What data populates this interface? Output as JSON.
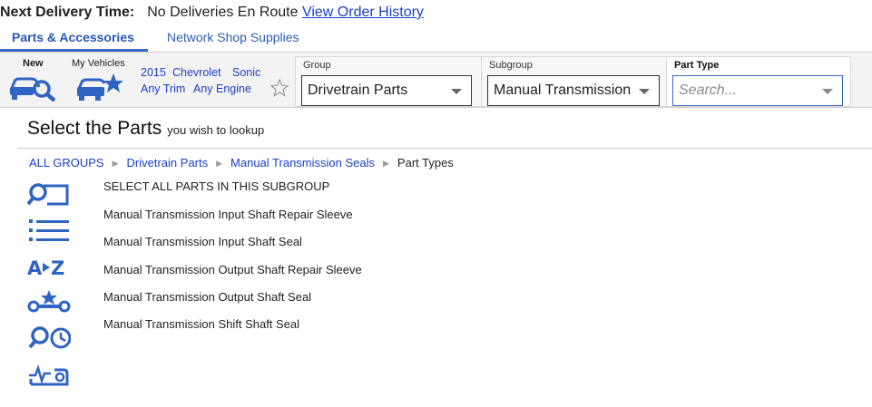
{
  "delivery": {
    "label": "Next Delivery Time:",
    "status": "No Deliveries En Route",
    "history_link": "View Order History"
  },
  "tabs": [
    {
      "label": "Parts & Accessories",
      "active": true
    },
    {
      "label": "Network Shop Supplies",
      "active": false
    }
  ],
  "vehicle": {
    "new_label": "New",
    "my_vehicles_label": "My Vehicles",
    "year": "2015",
    "make": "Chevrolet",
    "model": "Sonic",
    "trim": "Any Trim",
    "engine": "Any Engine"
  },
  "filters": {
    "group_label": "Group",
    "group_value": "Drivetrain Parts",
    "subgroup_label": "Subgroup",
    "subgroup_value": "Manual Transmission Seals",
    "part_type_label": "Part Type",
    "part_type_placeholder": "Search..."
  },
  "heading": {
    "title": "Select the Parts",
    "subtitle": "you wish to lookup"
  },
  "breadcrumb": [
    "ALL GROUPS",
    "Drivetrain Parts",
    "Manual Transmission Seals",
    "Part Types"
  ],
  "side_icons": [
    "search-part-icon",
    "list-view-icon",
    "a-to-z-icon",
    "tools-icon",
    "search-time-icon",
    "diagnostics-icon"
  ],
  "parts": [
    "SELECT ALL PARTS IN THIS SUBGROUP",
    "Manual Transmission Input Shaft Repair Sleeve",
    "Manual Transmission Input Shaft Seal",
    "Manual Transmission Output Shaft Repair Sleeve",
    "Manual Transmission Output Shaft Seal",
    "Manual Transmission Shift Shaft Seal"
  ],
  "colors": {
    "accent": "#3a67c2",
    "link": "#1a3fc9"
  }
}
